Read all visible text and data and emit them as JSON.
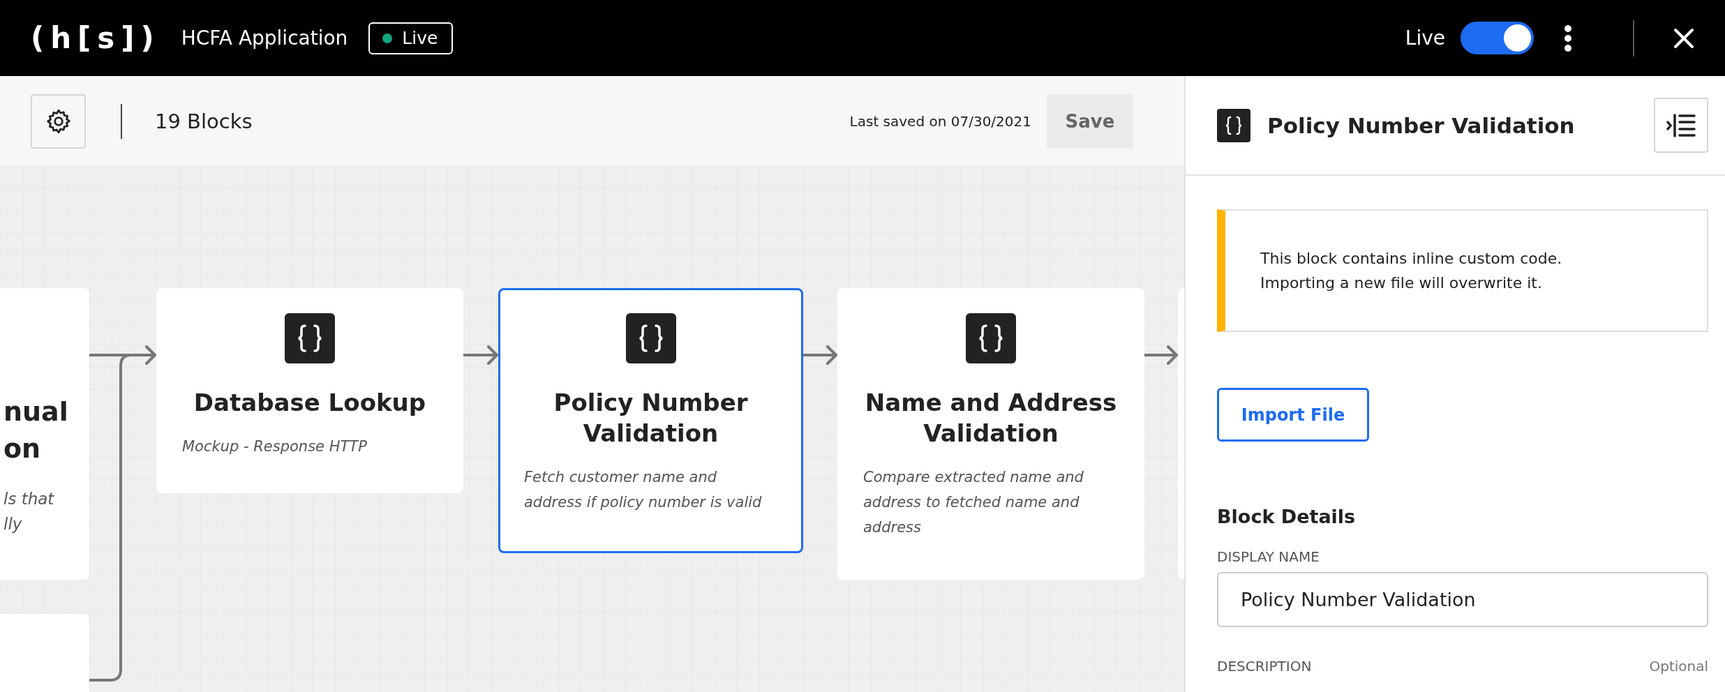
{
  "top_bar": {
    "logo": "(h[s])",
    "app_name": "HCFA Application",
    "status_badge": "Live",
    "live_toggle": {
      "label": "Live",
      "on": true
    }
  },
  "toolbar": {
    "block_count": "19 Blocks",
    "last_saved": "Last saved on 07/30/2021",
    "save_button": "Save"
  },
  "canvas": {
    "blocks": [
      {
        "kind": "clipped",
        "title_lines": [
          "nual",
          "on"
        ],
        "description_lines": [
          "ls that",
          "lly"
        ],
        "selected": false
      },
      {
        "kind": "full",
        "title": "Database Lookup",
        "description": "Mockup - Response HTTP",
        "selected": false
      },
      {
        "kind": "full",
        "title": "Policy Number Validation",
        "description": "Fetch customer name and address if policy number is valid",
        "selected": true
      },
      {
        "kind": "full",
        "title": "Name and Address Validation",
        "description": "Compare extracted name and address to fetched name and address",
        "selected": false
      },
      {
        "kind": "clipped",
        "selected": false
      },
      {
        "kind": "clipped",
        "selected": false
      }
    ]
  },
  "panel": {
    "title": "Policy Number Validation",
    "notice": "This block contains inline custom code.\nImporting a new file will overwrite it.",
    "import_button": "Import File",
    "section_title": "Block Details",
    "fields": [
      {
        "label": "DISPLAY NAME",
        "value": "Policy Number Validation"
      },
      {
        "label": "DESCRIPTION",
        "hint": "Optional"
      }
    ]
  }
}
